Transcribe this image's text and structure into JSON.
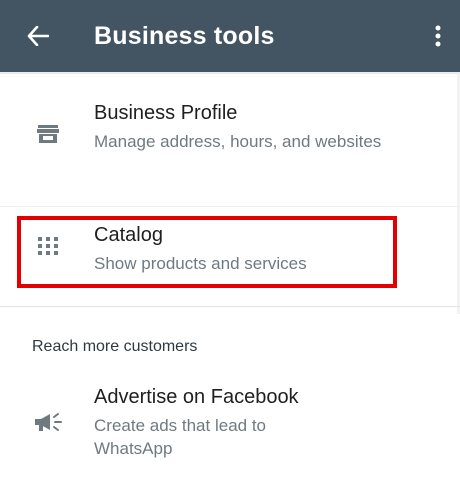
{
  "appbar": {
    "title": "Business tools",
    "back_icon": "arrow-left-icon",
    "more_icon": "more-vert-icon",
    "background": "#435563"
  },
  "items": [
    {
      "title": "Business Profile",
      "subtitle": "Manage address, hours, and websites",
      "icon": "storefront-icon"
    },
    {
      "title": "Catalog",
      "subtitle": "Show products and services",
      "icon": "grid-icon"
    }
  ],
  "section": {
    "title": "Reach more customers"
  },
  "advertise": {
    "title": "Advertise on Facebook",
    "subtitle": "Create ads that lead to WhatsApp",
    "icon": "megaphone-icon"
  },
  "highlight_color": "#e30000"
}
